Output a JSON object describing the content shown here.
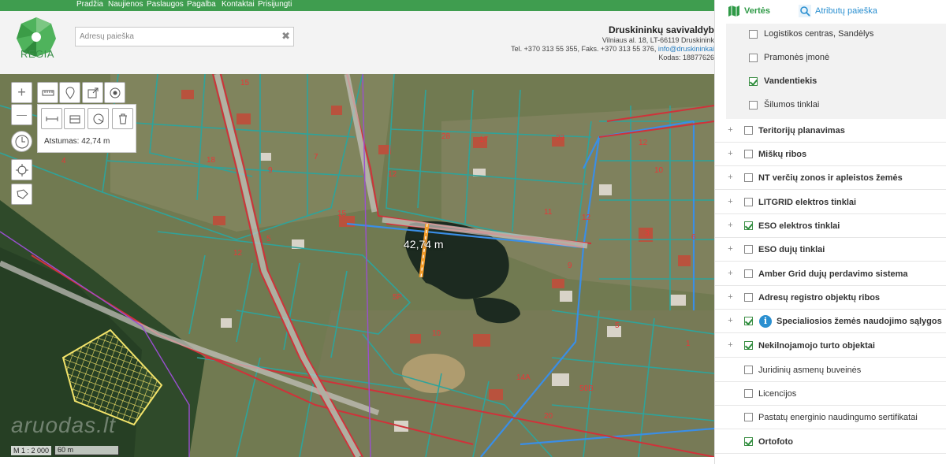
{
  "nav": [
    "Pradžia",
    "Naujienos",
    "Paslaugos",
    "Pagalba",
    "Kontaktai",
    "Prisijungti"
  ],
  "header": {
    "logo_text": "REGIA",
    "search_placeholder": "Adresų paieška",
    "municipality": {
      "name": "Druskininkų savivaldyb",
      "address": "Vilniaus al. 18, LT-66119 Druskinink",
      "tel_prefix": "Tel. +370 313 55 355, Faks. +370 313 55 376, ",
      "email": "info@druskininkai",
      "code": "Kodas: 18877626"
    }
  },
  "map": {
    "measure_text": "Atstumas: 42,74 m",
    "measure_label": "42,74 m",
    "scale_ratio": "M 1 : 2 000",
    "scale_bar": "60 m",
    "watermark": "aruodas.lt",
    "tools": {
      "zoom_in": "+",
      "zoom_out": "—"
    }
  },
  "sidebar": {
    "tabs": {
      "layers": "Vertės",
      "attr_search": "Atributų paieška"
    },
    "sub_items": [
      {
        "label": "Logistikos centras, Sandėlys",
        "checked": false,
        "bold": false
      },
      {
        "label": "Pramonės įmonė",
        "checked": false,
        "bold": false
      },
      {
        "label": "Vandentiekis",
        "checked": true,
        "bold": true
      },
      {
        "label": "Šilumos tinklai",
        "checked": false,
        "bold": false
      }
    ],
    "groups": [
      {
        "label": "Teritorijų planavimas",
        "checked": false,
        "expandable": true,
        "bold": true
      },
      {
        "label": "Miškų ribos",
        "checked": false,
        "expandable": true,
        "bold": true
      },
      {
        "label": "NT verčių zonos ir apleistos žemės",
        "checked": false,
        "expandable": true,
        "bold": true
      },
      {
        "label": "LITGRID elektros tinklai",
        "checked": false,
        "expandable": true,
        "bold": true
      },
      {
        "label": "ESO elektros tinklai",
        "checked": true,
        "expandable": true,
        "bold": true
      },
      {
        "label": "ESO dujų tinklai",
        "checked": false,
        "expandable": true,
        "bold": true
      },
      {
        "label": "Amber Grid dujų perdavimo sistema",
        "checked": false,
        "expandable": true,
        "bold": true
      },
      {
        "label": "Adresų registro objektų ribos",
        "checked": false,
        "expandable": true,
        "bold": true
      },
      {
        "label": "Specialiosios žemės naudojimo sąlygos",
        "checked": true,
        "expandable": true,
        "bold": true,
        "info": true
      },
      {
        "label": "Nekilnojamojo turto objektai",
        "checked": true,
        "expandable": true,
        "bold": true
      },
      {
        "label": "Juridinių asmenų buveinės",
        "checked": false,
        "expandable": false,
        "bold": false
      },
      {
        "label": "Licencijos",
        "checked": false,
        "expandable": false,
        "bold": false
      },
      {
        "label": "Pastatų energinio naudingumo sertifikatai",
        "checked": false,
        "expandable": false,
        "bold": false
      },
      {
        "label": "Ortofoto",
        "checked": true,
        "expandable": false,
        "bold": true
      }
    ],
    "info_glyph": "i",
    "expander_glyph": "+"
  },
  "colors": {
    "brand_green": "#3f9d4f",
    "link_blue": "#2a8fd0",
    "parcel_teal": "#2fa39a",
    "road_red": "#d0323a",
    "water_blue": "#3a8ee6"
  }
}
